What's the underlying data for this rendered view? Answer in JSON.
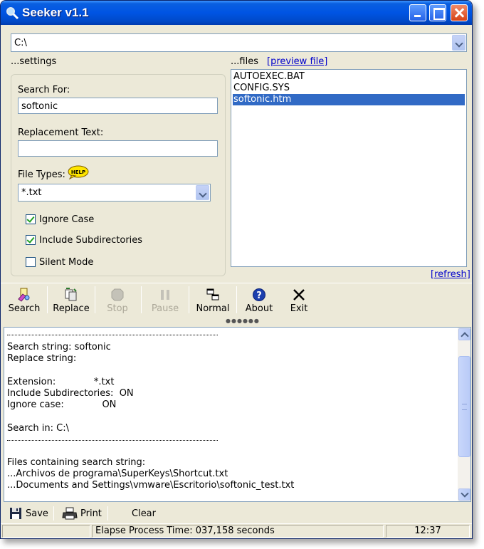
{
  "window": {
    "title": "Seeker v1.1"
  },
  "path": {
    "value": "C:\\"
  },
  "settings": {
    "section_label": "...settings",
    "search_for_label": "Search For:",
    "search_for_value": "softonic",
    "replacement_label": "Replacement Text:",
    "replacement_value": "",
    "file_types_label": "File Types:",
    "help_badge": "HELP",
    "file_types_value": "*.txt",
    "options": [
      {
        "label": "Ignore Case",
        "checked": true
      },
      {
        "label": "Include Subdirectories",
        "checked": true
      },
      {
        "label": "Silent Mode",
        "checked": false
      }
    ]
  },
  "files": {
    "section_label": "...files",
    "preview_link": "[preview file]",
    "refresh_link": "[refresh]",
    "items": [
      {
        "name": "AUTOEXEC.BAT",
        "selected": false
      },
      {
        "name": "CONFIG.SYS",
        "selected": false
      },
      {
        "name": "softonic.htm",
        "selected": true
      }
    ]
  },
  "toolbar": {
    "search": "Search",
    "replace": "Replace",
    "stop": "Stop",
    "pause": "Pause",
    "normal": "Normal",
    "about": "About",
    "exit": "Exit"
  },
  "log": {
    "separator": "------------------------------------------------------------",
    "search_string": "Search string: softonic",
    "replace_string": "Replace string:",
    "extension": "Extension:             *.txt",
    "include_subdirs": "Include Subdirectories:  ON",
    "ignore_case": "Ignore case:             ON",
    "search_in": "Search in: C:\\",
    "files_heading": "Files containing search string:",
    "result_1": "...Archivos de programa\\SuperKeys\\Shortcut.txt",
    "result_2": "...Documents and Settings\\vmware\\Escritorio\\softonic_test.txt"
  },
  "bottom": {
    "save": "Save",
    "print": "Print",
    "clear": "Clear"
  },
  "status": {
    "elapsed": "Elapse Process Time: 037,158 seconds",
    "time": "12:37"
  }
}
